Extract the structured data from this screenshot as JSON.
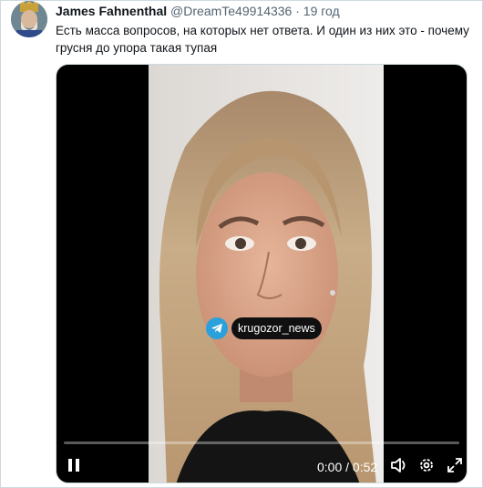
{
  "tweet": {
    "author_name": "James Fahnenthal",
    "handle": "@DreamTe49914336",
    "separator": "·",
    "time": "19 год",
    "text": "Есть масса вопросов, на которых нет ответа. И один из них это - почему грусня до упора такая тупая"
  },
  "video": {
    "watermark": "krugozor_news",
    "current_time": "0:00",
    "time_sep": " / ",
    "duration": "0:52",
    "progress": 0.0
  },
  "icons": {
    "pause": "pause-icon",
    "volume": "volume-icon",
    "settings": "gear-icon",
    "fullscreen": "fullscreen-icon",
    "telegram": "telegram-icon"
  },
  "colors": {
    "text_primary": "#0f1419",
    "text_secondary": "#536471",
    "telegram": "#2aa1da",
    "video_bg": "#000000"
  }
}
